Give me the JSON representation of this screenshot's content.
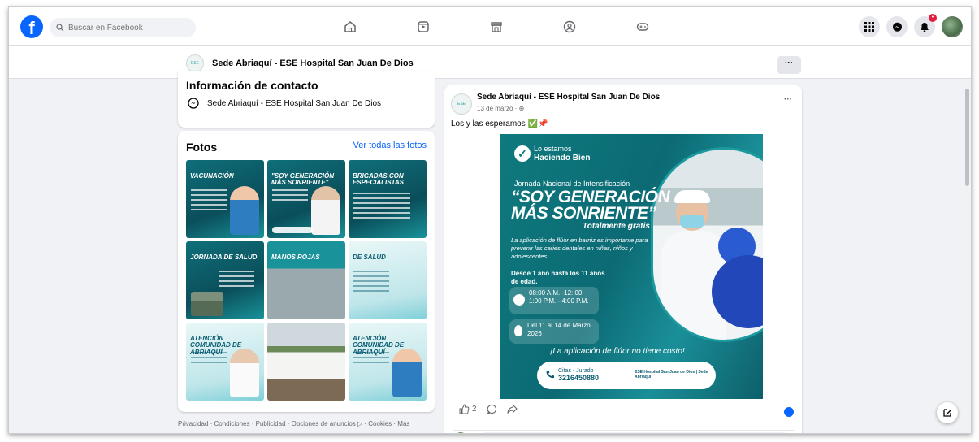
{
  "topnav": {
    "search_placeholder": "Buscar en Facebook",
    "notification_badge": "•"
  },
  "page": {
    "name": "Sede Abriaquí - ESE Hospital San Juan De Dios",
    "more_label": "···"
  },
  "contact": {
    "heading": "Información de contacto",
    "messenger_name": "Sede Abriaquí - ESE Hospital San Juan De Dios"
  },
  "photos": {
    "heading": "Fotos",
    "see_all": "Ver todas las fotos",
    "tiles": [
      {
        "title": "Vacunación"
      },
      {
        "title": "\"Soy generación más sonriente\""
      },
      {
        "title": "Brigadas con especialistas"
      },
      {
        "title": "Jornada de salud"
      },
      {
        "title": "Manos rojas"
      },
      {
        "title": "de salud"
      },
      {
        "title": "Atención comunidad de Abriaquí"
      },
      {
        "title": ""
      },
      {
        "title": "Atención comunidad de Abriaquí"
      }
    ]
  },
  "footer": {
    "text": "Privacidad · Condiciones · Publicidad · Opciones de anuncios ▷ · Cookies · Más"
  },
  "post": {
    "author": "Sede Abriaquí - ESE Hospital San Juan De Dios",
    "date": "13 de marzo · ",
    "text": "Los y las esperamos ✅📌",
    "more_label": "···",
    "likes_count": "2",
    "flyer": {
      "lo_estamos": "Lo estamos",
      "haciendo_bien": "Haciendo Bien",
      "jornada": "Jornada Nacional de Intensificación",
      "title_line1": "“SOY GENERACIÓN",
      "title_line2": "MÁS SONRIENTE”",
      "gratis": "Totalmente gratis",
      "description": "La aplicación de flúor en barniz es importante para prevenir las caries dentales en niñas, niños y adolescentes.",
      "age": "Desde 1 año hasta los 11 años de edad.",
      "hours_line1": "08:00 A.M. -12: 00",
      "hours_line2": "1:00 P.M. - 4:00 P.M.",
      "dates_line1": "Del 11 al 14 de Marzo",
      "dates_line2": "2026",
      "costo": "¡La aplicación de flúor no tiene costo!",
      "phone_label": "Citas - Jurado",
      "phone": "3216450880",
      "hospital_label": "ESE Hospital San Juan de Dios | Sede Abriaquí"
    }
  },
  "colors": {
    "brand": "#0866ff",
    "flyer_teal": "#0e7a7e",
    "badge_red": "#e41e3f"
  }
}
